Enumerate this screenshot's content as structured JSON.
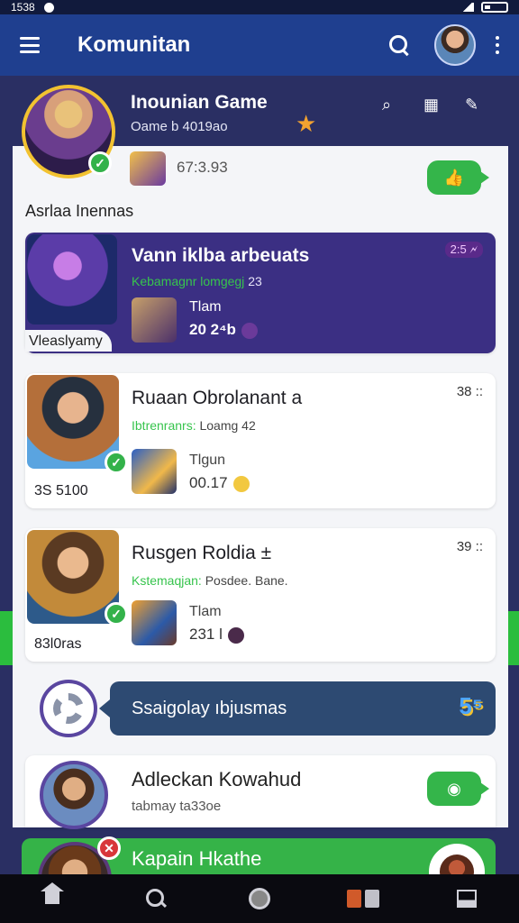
{
  "status_bar": {
    "time": "1538"
  },
  "app_bar": {
    "title": "Komunitan"
  },
  "community": {
    "name": "Inounian Game",
    "subtitle": "Oame b 4019ao"
  },
  "pinned": {
    "value": "67:3.93"
  },
  "section": {
    "title": "Asrlaa Inennas"
  },
  "cards": [
    {
      "title": "Vann iklba arbeuats",
      "kicker_green": "Kebamagnr lomgegj",
      "kicker_rest": "23",
      "sub_label": "Tlam",
      "sub_value": "20 2⁴b",
      "card_label": "Vleaslyamy",
      "meta": "2:5 🗲"
    },
    {
      "title": "Ruaan Obrolanant a",
      "kicker_green": "Ibtrenranrs:",
      "kicker_rest": "Loamg 42",
      "sub_label": "Tlgun",
      "sub_value": "00.17",
      "card_label": "3S 5100",
      "meta": "38 ::"
    },
    {
      "title": "Rusgen Roldia  ±",
      "kicker_green": "Kstemaqjan:",
      "kicker_rest": "Posdee. Bane.",
      "sub_label": "Tlam",
      "sub_value": "231 l",
      "card_label": "83l0ras",
      "meta": "39 ::"
    }
  ],
  "group": {
    "label": "Ssaigolay ıbjusmas",
    "badge": "5⁵"
  },
  "user": {
    "name": "Adleckan Kowahud",
    "subtitle": "tabmay ta33oe"
  },
  "bottom_card": {
    "title": "Kapain Hkathe"
  }
}
